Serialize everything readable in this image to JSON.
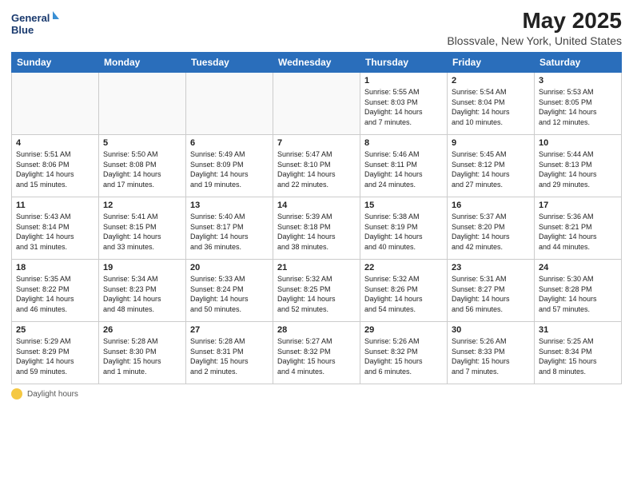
{
  "header": {
    "logo_line1": "General",
    "logo_line2": "Blue",
    "title": "May 2025",
    "subtitle": "Blossvale, New York, United States"
  },
  "days_of_week": [
    "Sunday",
    "Monday",
    "Tuesday",
    "Wednesday",
    "Thursday",
    "Friday",
    "Saturday"
  ],
  "weeks": [
    [
      {
        "day": "",
        "info": ""
      },
      {
        "day": "",
        "info": ""
      },
      {
        "day": "",
        "info": ""
      },
      {
        "day": "",
        "info": ""
      },
      {
        "day": "1",
        "info": "Sunrise: 5:55 AM\nSunset: 8:03 PM\nDaylight: 14 hours\nand 7 minutes."
      },
      {
        "day": "2",
        "info": "Sunrise: 5:54 AM\nSunset: 8:04 PM\nDaylight: 14 hours\nand 10 minutes."
      },
      {
        "day": "3",
        "info": "Sunrise: 5:53 AM\nSunset: 8:05 PM\nDaylight: 14 hours\nand 12 minutes."
      }
    ],
    [
      {
        "day": "4",
        "info": "Sunrise: 5:51 AM\nSunset: 8:06 PM\nDaylight: 14 hours\nand 15 minutes."
      },
      {
        "day": "5",
        "info": "Sunrise: 5:50 AM\nSunset: 8:08 PM\nDaylight: 14 hours\nand 17 minutes."
      },
      {
        "day": "6",
        "info": "Sunrise: 5:49 AM\nSunset: 8:09 PM\nDaylight: 14 hours\nand 19 minutes."
      },
      {
        "day": "7",
        "info": "Sunrise: 5:47 AM\nSunset: 8:10 PM\nDaylight: 14 hours\nand 22 minutes."
      },
      {
        "day": "8",
        "info": "Sunrise: 5:46 AM\nSunset: 8:11 PM\nDaylight: 14 hours\nand 24 minutes."
      },
      {
        "day": "9",
        "info": "Sunrise: 5:45 AM\nSunset: 8:12 PM\nDaylight: 14 hours\nand 27 minutes."
      },
      {
        "day": "10",
        "info": "Sunrise: 5:44 AM\nSunset: 8:13 PM\nDaylight: 14 hours\nand 29 minutes."
      }
    ],
    [
      {
        "day": "11",
        "info": "Sunrise: 5:43 AM\nSunset: 8:14 PM\nDaylight: 14 hours\nand 31 minutes."
      },
      {
        "day": "12",
        "info": "Sunrise: 5:41 AM\nSunset: 8:15 PM\nDaylight: 14 hours\nand 33 minutes."
      },
      {
        "day": "13",
        "info": "Sunrise: 5:40 AM\nSunset: 8:17 PM\nDaylight: 14 hours\nand 36 minutes."
      },
      {
        "day": "14",
        "info": "Sunrise: 5:39 AM\nSunset: 8:18 PM\nDaylight: 14 hours\nand 38 minutes."
      },
      {
        "day": "15",
        "info": "Sunrise: 5:38 AM\nSunset: 8:19 PM\nDaylight: 14 hours\nand 40 minutes."
      },
      {
        "day": "16",
        "info": "Sunrise: 5:37 AM\nSunset: 8:20 PM\nDaylight: 14 hours\nand 42 minutes."
      },
      {
        "day": "17",
        "info": "Sunrise: 5:36 AM\nSunset: 8:21 PM\nDaylight: 14 hours\nand 44 minutes."
      }
    ],
    [
      {
        "day": "18",
        "info": "Sunrise: 5:35 AM\nSunset: 8:22 PM\nDaylight: 14 hours\nand 46 minutes."
      },
      {
        "day": "19",
        "info": "Sunrise: 5:34 AM\nSunset: 8:23 PM\nDaylight: 14 hours\nand 48 minutes."
      },
      {
        "day": "20",
        "info": "Sunrise: 5:33 AM\nSunset: 8:24 PM\nDaylight: 14 hours\nand 50 minutes."
      },
      {
        "day": "21",
        "info": "Sunrise: 5:32 AM\nSunset: 8:25 PM\nDaylight: 14 hours\nand 52 minutes."
      },
      {
        "day": "22",
        "info": "Sunrise: 5:32 AM\nSunset: 8:26 PM\nDaylight: 14 hours\nand 54 minutes."
      },
      {
        "day": "23",
        "info": "Sunrise: 5:31 AM\nSunset: 8:27 PM\nDaylight: 14 hours\nand 56 minutes."
      },
      {
        "day": "24",
        "info": "Sunrise: 5:30 AM\nSunset: 8:28 PM\nDaylight: 14 hours\nand 57 minutes."
      }
    ],
    [
      {
        "day": "25",
        "info": "Sunrise: 5:29 AM\nSunset: 8:29 PM\nDaylight: 14 hours\nand 59 minutes."
      },
      {
        "day": "26",
        "info": "Sunrise: 5:28 AM\nSunset: 8:30 PM\nDaylight: 15 hours\nand 1 minute."
      },
      {
        "day": "27",
        "info": "Sunrise: 5:28 AM\nSunset: 8:31 PM\nDaylight: 15 hours\nand 2 minutes."
      },
      {
        "day": "28",
        "info": "Sunrise: 5:27 AM\nSunset: 8:32 PM\nDaylight: 15 hours\nand 4 minutes."
      },
      {
        "day": "29",
        "info": "Sunrise: 5:26 AM\nSunset: 8:32 PM\nDaylight: 15 hours\nand 6 minutes."
      },
      {
        "day": "30",
        "info": "Sunrise: 5:26 AM\nSunset: 8:33 PM\nDaylight: 15 hours\nand 7 minutes."
      },
      {
        "day": "31",
        "info": "Sunrise: 5:25 AM\nSunset: 8:34 PM\nDaylight: 15 hours\nand 8 minutes."
      }
    ]
  ],
  "footer": {
    "daylight_label": "Daylight hours"
  }
}
